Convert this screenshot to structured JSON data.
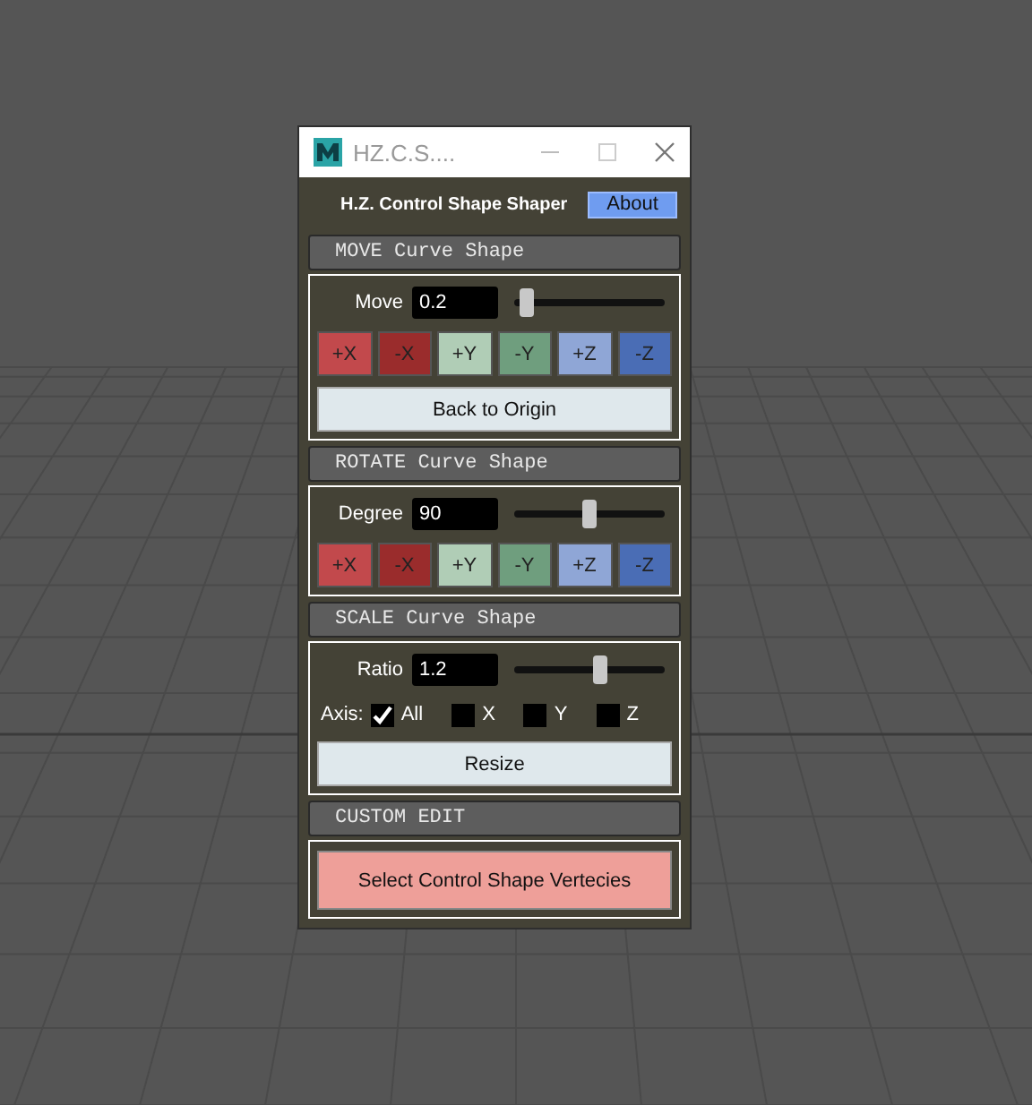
{
  "window": {
    "title": "HZ.C.S....",
    "heading": "H.Z. Control Shape Shaper",
    "about_button": "About"
  },
  "sections": [
    {
      "kind": "axis",
      "title": "MOVE Curve Shape",
      "field_label": "Move",
      "value": "0.2",
      "level": 0.04,
      "buttons": [
        {
          "label": "+X",
          "color": "#c2494c"
        },
        {
          "label": "-X",
          "color": "#9a2c2c"
        },
        {
          "label": "+Y",
          "color": "#b0cdb6"
        },
        {
          "label": "-Y",
          "color": "#6f9e7e"
        },
        {
          "label": "+Z",
          "color": "#8fa6d6"
        },
        {
          "label": "-Z",
          "color": "#4a6db5"
        }
      ],
      "action": "Back to Origin"
    },
    {
      "kind": "axis",
      "title": "ROTATE Curve Shape",
      "field_label": "Degree",
      "value": "90",
      "level": 0.5,
      "buttons": [
        {
          "label": "+X",
          "color": "#c2494c"
        },
        {
          "label": "-X",
          "color": "#9a2c2c"
        },
        {
          "label": "+Y",
          "color": "#b0cdb6"
        },
        {
          "label": "-Y",
          "color": "#6f9e7e"
        },
        {
          "label": "+Z",
          "color": "#8fa6d6"
        },
        {
          "label": "-Z",
          "color": "#4a6db5"
        }
      ]
    },
    {
      "kind": "scale",
      "title": "SCALE Curve Shape",
      "field_label": "Ratio",
      "value": "1.2",
      "level": 0.58,
      "axis_label": "Axis:",
      "checkboxes": [
        {
          "label": "All",
          "checked": true
        },
        {
          "label": "X",
          "checked": false
        },
        {
          "label": "Y",
          "checked": false
        },
        {
          "label": "Z",
          "checked": false
        }
      ],
      "action": "Resize"
    },
    {
      "kind": "custom",
      "title": "CUSTOM EDIT",
      "action": "Select Control Shape Vertecies"
    }
  ]
}
